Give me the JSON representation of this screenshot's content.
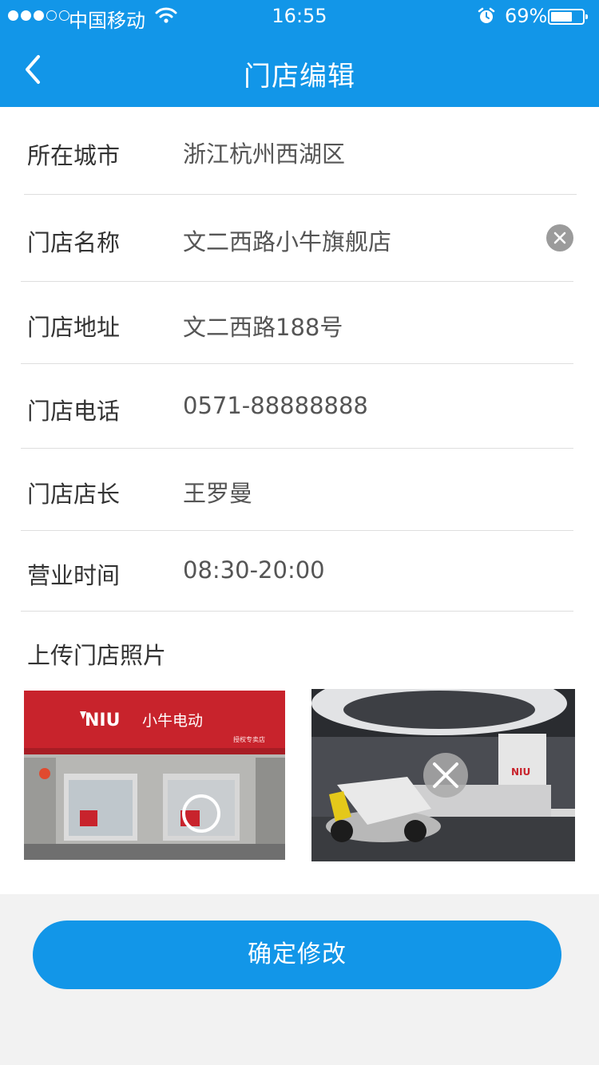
{
  "status_bar": {
    "carrier": "中国移动",
    "time": "16:55",
    "battery_percent": "69%",
    "battery_level": 0.69,
    "signal_strength": 3,
    "signal_max": 5
  },
  "nav": {
    "back_icon": "chevron-left-icon",
    "title": "门店编辑"
  },
  "form": {
    "city_label": "所在城市",
    "city_value": "浙江杭州西湖区",
    "name_label": "门店名称",
    "name_value": "文二西路小牛旗舰店",
    "address_label": "门店地址",
    "address_value": "文二西路188号",
    "phone_label": "门店电话",
    "phone_value": "0571-88888888",
    "manager_label": "门店店长",
    "manager_value": "王罗曼",
    "hours_label": "营业时间",
    "hours_value": "08:30-20:00"
  },
  "photos": {
    "label": "上传门店照片",
    "store_sign_brand": "NIU",
    "store_sign_text": "小牛电动",
    "store_sign_sub": "授权专卖店",
    "showroom_logo": "NIU"
  },
  "actions": {
    "submit_label": "确定修改"
  },
  "colors": {
    "primary": "#1296e8",
    "background": "#f2f2f2"
  }
}
